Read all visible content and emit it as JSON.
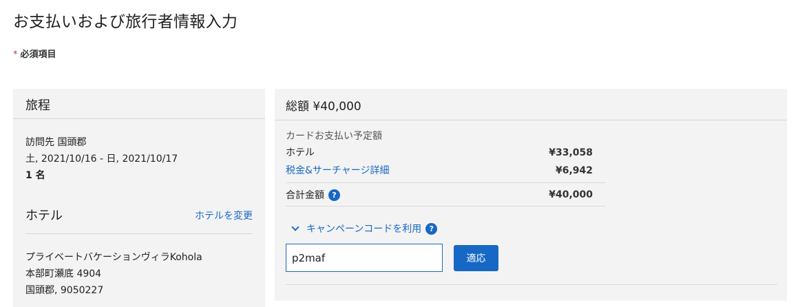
{
  "page": {
    "title": "お支払いおよび旅行者情報入力",
    "required_star": "*",
    "required_note": "必須項目"
  },
  "itinerary": {
    "header": "旅程",
    "visit_destination": "訪問先 国頭郡",
    "dates": "土, 2021/10/16 - 日, 2021/10/17",
    "guests": "1 名",
    "hotel_header": "ホテル",
    "change_hotel_link": "ホテルを変更",
    "hotel_name": "プライベートバケーションヴィラKohola",
    "hotel_address": "本部町瀬底 4904",
    "hotel_city": "国頭郡, 9050227"
  },
  "payment": {
    "total_header": "総額 ¥40,000",
    "card_label": "カードお支払い予定額",
    "hotel_label": "ホテル",
    "hotel_amount": "¥33,058",
    "tax_link": "税金&サーチャージ詳細",
    "tax_amount": "¥6,942",
    "total_label": "合計金額",
    "total_amount": "¥40,000",
    "help_glyph": "?",
    "campaign_toggle_label": "キャンペーンコードを利用",
    "campaign_code_value": "p2maf",
    "apply_button": "適応"
  },
  "icons": {
    "help": "question-circle-icon",
    "chevron": "chevron-down-icon"
  },
  "colors": {
    "accent": "#1668c4",
    "panel_bg": "#f3f3f3",
    "required_star": "#d32f2f"
  }
}
